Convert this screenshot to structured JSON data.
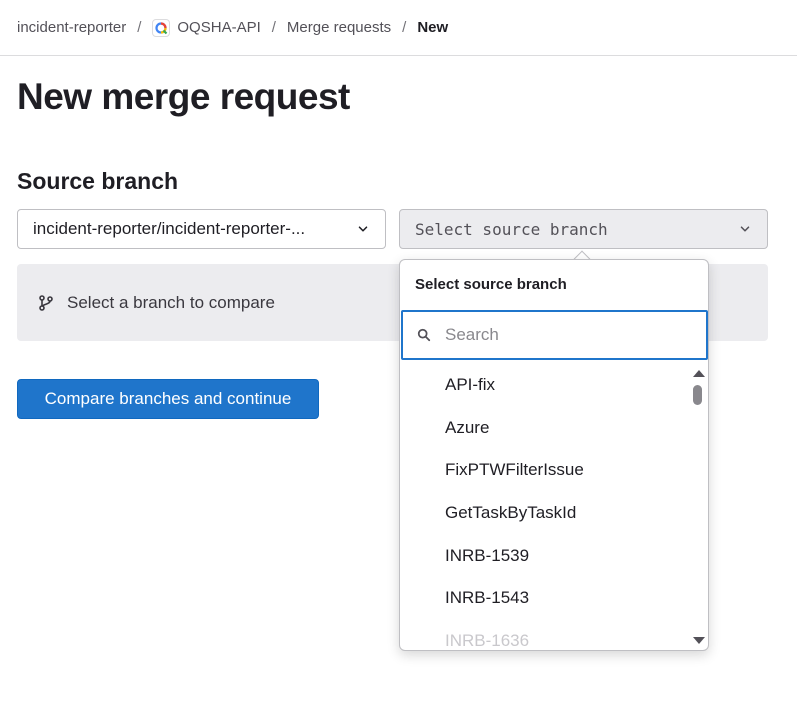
{
  "breadcrumb": {
    "items": [
      "incident-reporter",
      "OQSHA-API",
      "Merge requests",
      "New"
    ],
    "separator": "/"
  },
  "page": {
    "title": "New merge request",
    "source_section_title": "Source branch"
  },
  "source": {
    "project_value": "incident-reporter/incident-reporter-...",
    "branch_placeholder": "Select source branch",
    "compare_hint": "Select a branch to compare"
  },
  "actions": {
    "compare_label": "Compare branches and continue"
  },
  "dropdown": {
    "header": "Select source branch",
    "search_placeholder": "Search",
    "items": [
      "API-fix",
      "Azure",
      "FixPTWFilterIssue",
      "GetTaskByTaskId",
      "INRB-1539",
      "INRB-1543",
      "INRB-1636"
    ]
  },
  "colors": {
    "primary": "#1f75cb",
    "focus": "#1f75cb",
    "muted_background": "#ececef"
  },
  "icons": {
    "project": "project-avatar-q-icon",
    "chevron": "chevron-down-icon",
    "branch": "branch-icon",
    "search": "search-icon"
  }
}
